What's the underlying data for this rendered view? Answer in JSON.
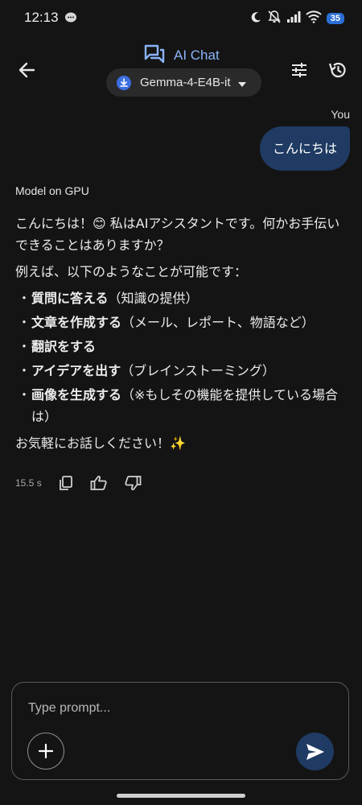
{
  "status_bar": {
    "time": "12:13",
    "battery": "35"
  },
  "header": {
    "title": "AI Chat",
    "model_name": "Gemma-4-E4B-it"
  },
  "chat": {
    "user_label": "You",
    "user_message": "こんにちは",
    "model_label": "Model on GPU",
    "response": {
      "intro": "こんにちは！😊 私はAIアシスタントです。何かお手伝いできることはありますか？",
      "examples_lead": "例えば、以下のようなことが可能です：",
      "bullet_symbol": "・",
      "items": [
        {
          "bold": "質問に答える",
          "rest": "（知識の提供）"
        },
        {
          "bold": "文章を作成する",
          "rest": "（メール、レポート、物語など）"
        },
        {
          "bold": "翻訳をする",
          "rest": ""
        },
        {
          "bold": "アイデアを出す",
          "rest": "（ブレインストーミング）"
        },
        {
          "bold": "画像を生成する",
          "rest": "（※もしその機能を提供している場合は）"
        }
      ],
      "closing": "お気軽にお話しください！✨"
    },
    "latency": "15.5 s"
  },
  "input": {
    "placeholder": "Type prompt..."
  },
  "colors": {
    "background": "#141414",
    "accent": "#8ab4f8",
    "user_bubble": "#1f3b63",
    "send_button": "#1f3b63"
  },
  "icons": {
    "back": "arrow-left-icon",
    "chat": "chat-forum-icon",
    "download": "download-icon",
    "tune": "tune-icon",
    "history": "history-icon",
    "copy": "copy-icon",
    "thumb_up": "thumb-up-icon",
    "thumb_down": "thumb-down-icon",
    "add": "plus-icon",
    "send": "send-icon"
  }
}
